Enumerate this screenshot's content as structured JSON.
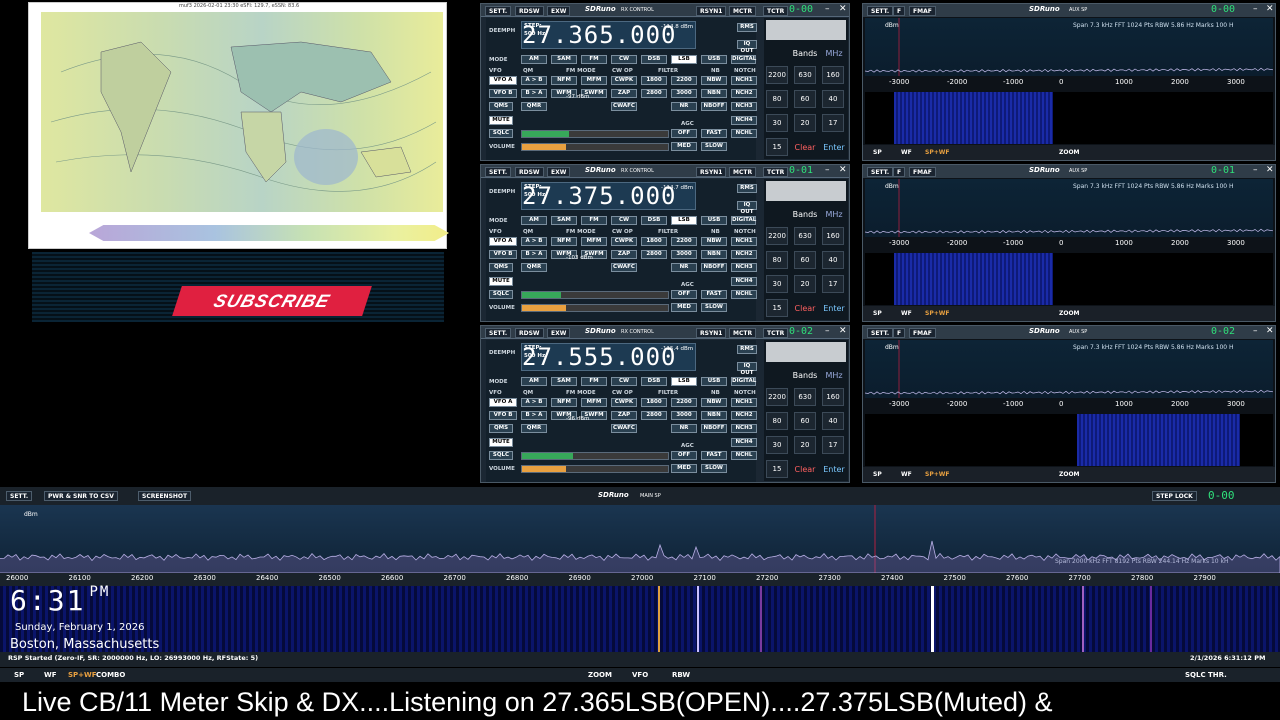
{
  "map": {
    "title": "muf3 2026-02-01 23:30 eSFI: 129.7, eSSN: 83.6"
  },
  "subscribe": {
    "logo_text": "SUBSCRIBE"
  },
  "rx_common": {
    "toolbar": [
      "SETT.",
      "RDSW",
      "EXW"
    ],
    "title": "SDRuno",
    "subtitle": "RX CONTROL",
    "right_buttons": [
      "RSYN1",
      "MCTR",
      "TCTR"
    ],
    "deemph": "DEEMPH",
    "step_label": "STEP:",
    "step_value": "500 Hz",
    "mode_label": "MODE",
    "modes": [
      "AM",
      "SAM",
      "FM",
      "CW",
      "DSB",
      "LSB",
      "USB",
      "DIGITAL"
    ],
    "vfoa": "VFO A",
    "vfob": "VFO B",
    "qms": "QMS",
    "mute": "MUTE",
    "sqlc": "SQLC",
    "volume": "VOLUME",
    "agc": "AGC",
    "fm_mode": "FM MODE",
    "cw_op": "CW OP",
    "filter": "FILTER",
    "nb": "NB",
    "notch": "NOTCH",
    "row1": [
      "A > B",
      "NFM",
      "MFM",
      "CWPK",
      "1800",
      "2200",
      "NBW",
      "NCH1"
    ],
    "row2": [
      "B > A",
      "WFM",
      "SWFM",
      "ZAP",
      "2800",
      "3000",
      "NBN",
      "NCH2"
    ],
    "row3": [
      "QMR",
      "CWAFC",
      "NR",
      "NBOFF",
      "NCH3"
    ],
    "agc_buttons": [
      "OFF",
      "FAST",
      "MED",
      "SLOW",
      "NCH4",
      "NCHL"
    ],
    "rms": "RMS",
    "iqout": "IQ OUT",
    "qm": "QM",
    "keypad": {
      "top": [
        "Bands",
        "MHz"
      ],
      "keys": [
        "2200",
        "630",
        "160",
        "80",
        "60",
        "40",
        "30",
        "20",
        "17",
        "15"
      ],
      "clear": "Clear",
      "enter": "Enter"
    }
  },
  "rx": [
    {
      "freq": "27.365.000",
      "signal": "-114.8 dBm",
      "smeter": "-97 dBm",
      "smeter_level": 0.32,
      "volume_level": 0.3,
      "counter": "0-00"
    },
    {
      "freq": "27.375.000",
      "signal": "-114.7 dBm",
      "smeter": "-103 dBm",
      "smeter_level": 0.27,
      "volume_level": 0.3,
      "counter": "0-01"
    },
    {
      "freq": "27.555.000",
      "signal": "-115.4 dBm",
      "smeter": "-96 dBm",
      "smeter_level": 0.35,
      "volume_level": 0.3,
      "counter": "0-02"
    }
  ],
  "aux_common": {
    "toolbar": [
      "SETT.",
      "F",
      "FMAF"
    ],
    "title": "SDRuno",
    "subtitle": "AUX SP",
    "info": "Span 7.3 kHz  FFT 1024 Pts  RBW 5.86 Hz  Marks 100 H",
    "ylabel": "dBm",
    "yticks": [
      "-20",
      "-30",
      "-40",
      "-50",
      "-60",
      "-70",
      "-80",
      "-90",
      "-100",
      "-110",
      "-120",
      "-130",
      "-140",
      "-150"
    ],
    "xticks": [
      "-3000",
      "-2000",
      "-1000",
      "0",
      "1000",
      "2000",
      "3000"
    ],
    "footer": [
      "SP",
      "WF",
      "SP+WF",
      "ZOOM"
    ]
  },
  "aux": [
    {
      "counter": "0-00",
      "wf_start": 0.07,
      "wf_end": 0.46
    },
    {
      "counter": "0-01",
      "wf_start": 0.07,
      "wf_end": 0.46
    },
    {
      "counter": "0-02",
      "wf_start": 0.52,
      "wf_end": 0.92
    }
  ],
  "main": {
    "toolbar": [
      "SETT.",
      "PWR & SNR TO CSV",
      "SCREENSHOT"
    ],
    "title": "SDRuno",
    "subtitle": "MAIN SP",
    "step_lock": "STEP LOCK",
    "counter": "0-00",
    "ylabel": "dBm",
    "info": "Span 2000 kHz  FFT 8192 Pts  RBW 244.14 Hz  Marks 10 kH",
    "xticks": [
      "26000",
      "26100",
      "26200",
      "26300",
      "26400",
      "26500",
      "26600",
      "26700",
      "26800",
      "26900",
      "27000",
      "27100",
      "27200",
      "27300",
      "27400",
      "27500",
      "27600",
      "27700",
      "27800",
      "27900"
    ],
    "status": "RSP Started (Zero-IF, SR: 2000000 Hz, LO: 26993000 Hz, RFState: 5)",
    "datetime": "2/1/2026 6:31:12 PM",
    "footer": [
      "SP",
      "WF",
      "SP+WF",
      "COMBO",
      "ZOOM",
      "VFO",
      "RBW",
      "SQLC THR."
    ]
  },
  "clock": {
    "time": "6:31",
    "ampm": "PM",
    "date": "Sunday, February 1, 2026",
    "location": "Boston, Massachusetts"
  },
  "ticker": {
    "text": "Live CB/11 Meter Skip & DX....Listening on 27.365LSB(OPEN)....27.375LSB(Muted) &"
  }
}
